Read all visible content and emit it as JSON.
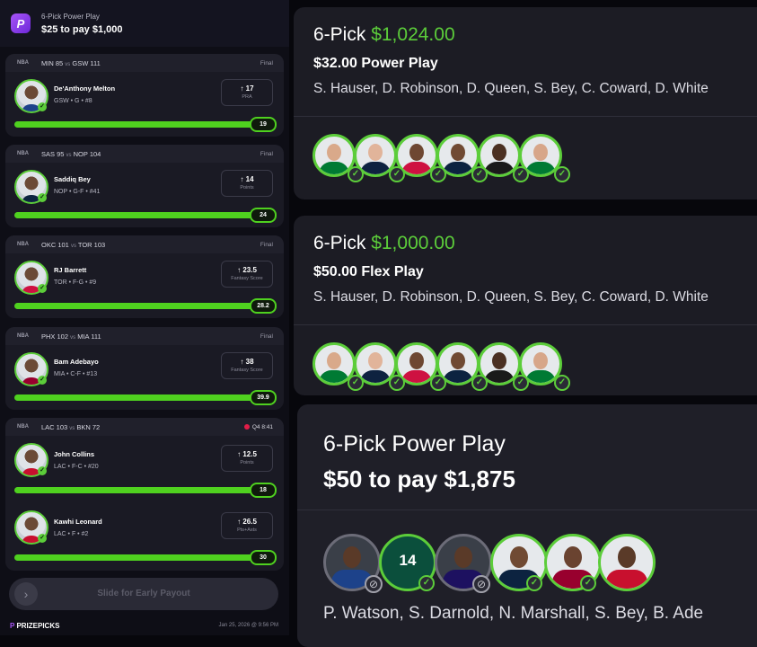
{
  "header": {
    "logo_letter": "P",
    "subtitle": "6-Pick Power Play",
    "title": "$25 to pay $1,000"
  },
  "picks": [
    {
      "league": "NBA",
      "away": "MIN 85",
      "vs": "vs",
      "home": "GSW 111",
      "status": "Final",
      "player": "De'Anthony Melton",
      "meta": "GSW • G • #8",
      "line": "↑ 17",
      "stat": "PRA",
      "result": "19",
      "progress": 1.0
    },
    {
      "league": "NBA",
      "away": "SAS 95",
      "vs": "vs",
      "home": "NOP 104",
      "status": "Final",
      "player": "Saddiq Bey",
      "meta": "NOP • G-F • #41",
      "line": "↑ 14",
      "stat": "Points",
      "result": "24",
      "progress": 1.0
    },
    {
      "league": "NBA",
      "away": "OKC 101",
      "vs": "vs",
      "home": "TOR 103",
      "status": "Final",
      "player": "RJ Barrett",
      "meta": "TOR • F-G • #9",
      "line": "↑ 23.5",
      "stat": "Fantasy Score",
      "result": "28.2",
      "progress": 1.0
    },
    {
      "league": "NBA",
      "away": "PHX 102",
      "vs": "vs",
      "home": "MIA 111",
      "status": "Final",
      "player": "Bam Adebayo",
      "meta": "MIA • C-F • #13",
      "line": "↑ 38",
      "stat": "Fantasy Score",
      "result": "39.9",
      "progress": 1.0
    },
    {
      "league": "NBA",
      "away": "LAC 103",
      "vs": "vs",
      "home": "BKN 72",
      "status": "Q4 8:41",
      "player": "John Collins",
      "meta": "LAC • F-C • #20",
      "line": "↑ 12.5",
      "stat": "Points",
      "result": "18",
      "progress": 1.0
    },
    {
      "player": "Kawhi Leonard",
      "meta": "LAC • F • #2",
      "line": "↑ 26.5",
      "stat": "Pts+Asts",
      "result": "30",
      "progress": 1.0
    }
  ],
  "slider": {
    "label": "Slide for Early Payout",
    "knob": "›"
  },
  "footer": {
    "brand_letter": "P",
    "brand": "PRIZEPICKS",
    "timestamp": "Jan 25, 2026 @ 9:56 PM"
  },
  "entries": [
    {
      "type": "6-Pick",
      "amount": "$1,024.00",
      "play": "$32.00 Power Play",
      "names": "S. Hauser, D. Robinson, D. Queen, S. Bey, C. Coward, D. White"
    },
    {
      "type": "6-Pick",
      "amount": "$1,000.00",
      "play": "$50.00 Flex Play",
      "names": "S. Hauser, D. Robinson, D. Queen, S. Bey, C. Coward, D. White"
    },
    {
      "title": "6-Pick Power Play",
      "payout": "$50 to pay $1,875",
      "names": "P. Watson, S. Darnold, N. Marshall, S. Bey, B. Ade",
      "jersey_number": "14"
    }
  ],
  "colors": {
    "accent": "#5ccd3a",
    "brand": "#a855f7",
    "live": "#e11d48"
  }
}
